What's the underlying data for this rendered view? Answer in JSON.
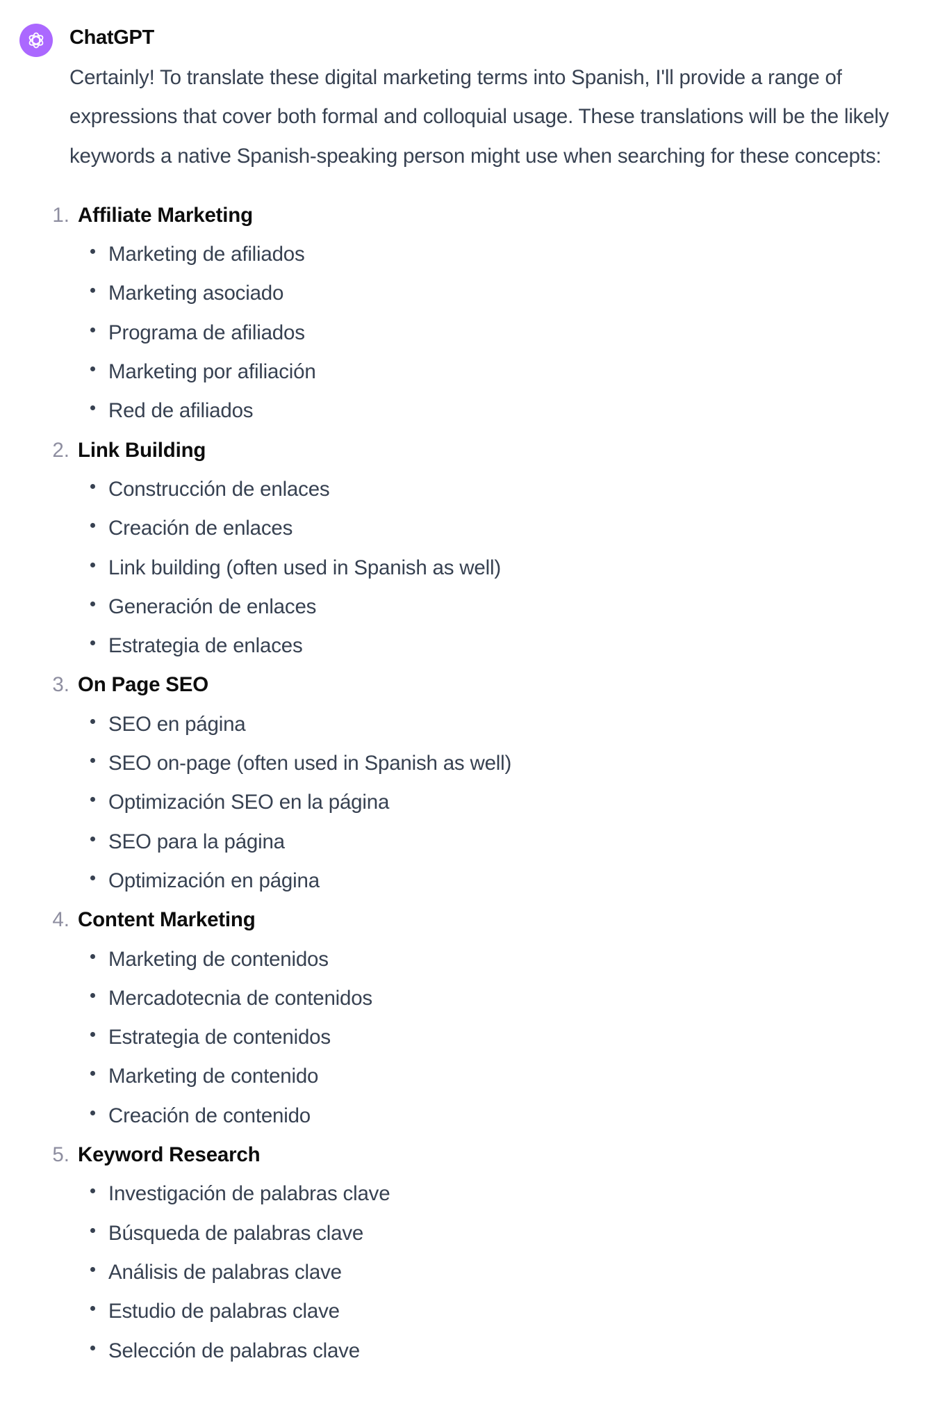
{
  "message": {
    "sender": "ChatGPT",
    "avatar_icon": "openai-logo-icon",
    "avatar_color": "#ab68ff",
    "intro": "Certainly! To translate these digital marketing terms into Spanish, I'll provide a range of expressions that cover both formal and colloquial usage. These translations will be the likely keywords a native Spanish-speaking person might use when searching for these concepts:",
    "sections": [
      {
        "number": "1.",
        "title": "Affiliate Marketing",
        "items": [
          "Marketing de afiliados",
          "Marketing asociado",
          "Programa de afiliados",
          "Marketing por afiliación",
          "Red de afiliados"
        ]
      },
      {
        "number": "2.",
        "title": "Link Building",
        "items": [
          "Construcción de enlaces",
          "Creación de enlaces",
          "Link building (often used in Spanish as well)",
          "Generación de enlaces",
          "Estrategia de enlaces"
        ]
      },
      {
        "number": "3.",
        "title": "On Page SEO",
        "items": [
          "SEO en página",
          "SEO on-page (often used in Spanish as well)",
          "Optimización SEO en la página",
          "SEO para la página",
          "Optimización en página"
        ]
      },
      {
        "number": "4.",
        "title": "Content Marketing",
        "items": [
          "Marketing de contenidos",
          "Mercadotecnia de contenidos",
          "Estrategia de contenidos",
          "Marketing de contenido",
          "Creación de contenido"
        ]
      },
      {
        "number": "5.",
        "title": "Keyword Research",
        "items": [
          "Investigación de palabras clave",
          "Búsqueda de palabras clave",
          "Análisis de palabras clave",
          "Estudio de palabras clave",
          "Selección de palabras clave"
        ]
      }
    ]
  }
}
